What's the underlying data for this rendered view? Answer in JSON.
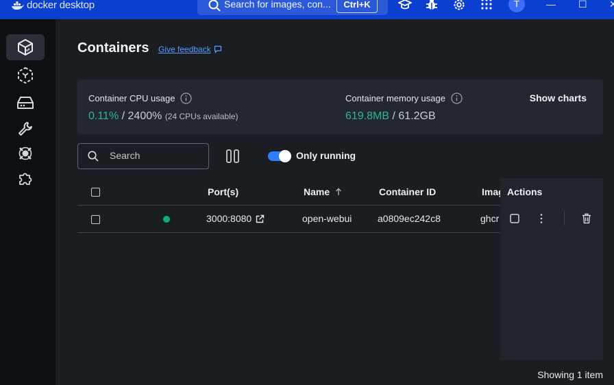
{
  "titlebar": {
    "app_name": "docker desktop",
    "search_placeholder": "Search for images, con...",
    "shortcut": "Ctrl+K",
    "user_initial": "T",
    "accent_color": "#0b3fd0"
  },
  "sidebar": {
    "items": [
      {
        "icon": "containers-icon",
        "active": true
      },
      {
        "icon": "images-icon"
      },
      {
        "icon": "volumes-icon"
      },
      {
        "icon": "builds-icon"
      },
      {
        "icon": "docker-scout-icon"
      },
      {
        "icon": "extensions-icon"
      }
    ]
  },
  "page": {
    "title": "Containers",
    "feedback_link": "Give feedback"
  },
  "stats": {
    "cpu_label": "Container CPU usage",
    "cpu_used": "0.11%",
    "cpu_sep": " / ",
    "cpu_total": "2400%",
    "cpu_note": "(24 CPUs available)",
    "mem_label": "Container memory usage",
    "mem_used": "619.8MB",
    "mem_sep": " / ",
    "mem_total": "61.2GB",
    "show_charts": "Show charts",
    "green_color": "#2fb58f"
  },
  "toolbar": {
    "search_placeholder": "Search",
    "only_running_label": "Only running",
    "only_running": true
  },
  "table": {
    "headers": {
      "ports": "Port(s)",
      "name": "Name",
      "container_id": "Container ID",
      "image": "Imag",
      "actions": "Actions"
    },
    "rows": [
      {
        "status": "running",
        "port": "3000:8080",
        "name": "open-webui",
        "container_id": "a0809ec242c8",
        "image": "ghcr"
      }
    ]
  },
  "footer": {
    "count_text": "Showing 1 item"
  }
}
